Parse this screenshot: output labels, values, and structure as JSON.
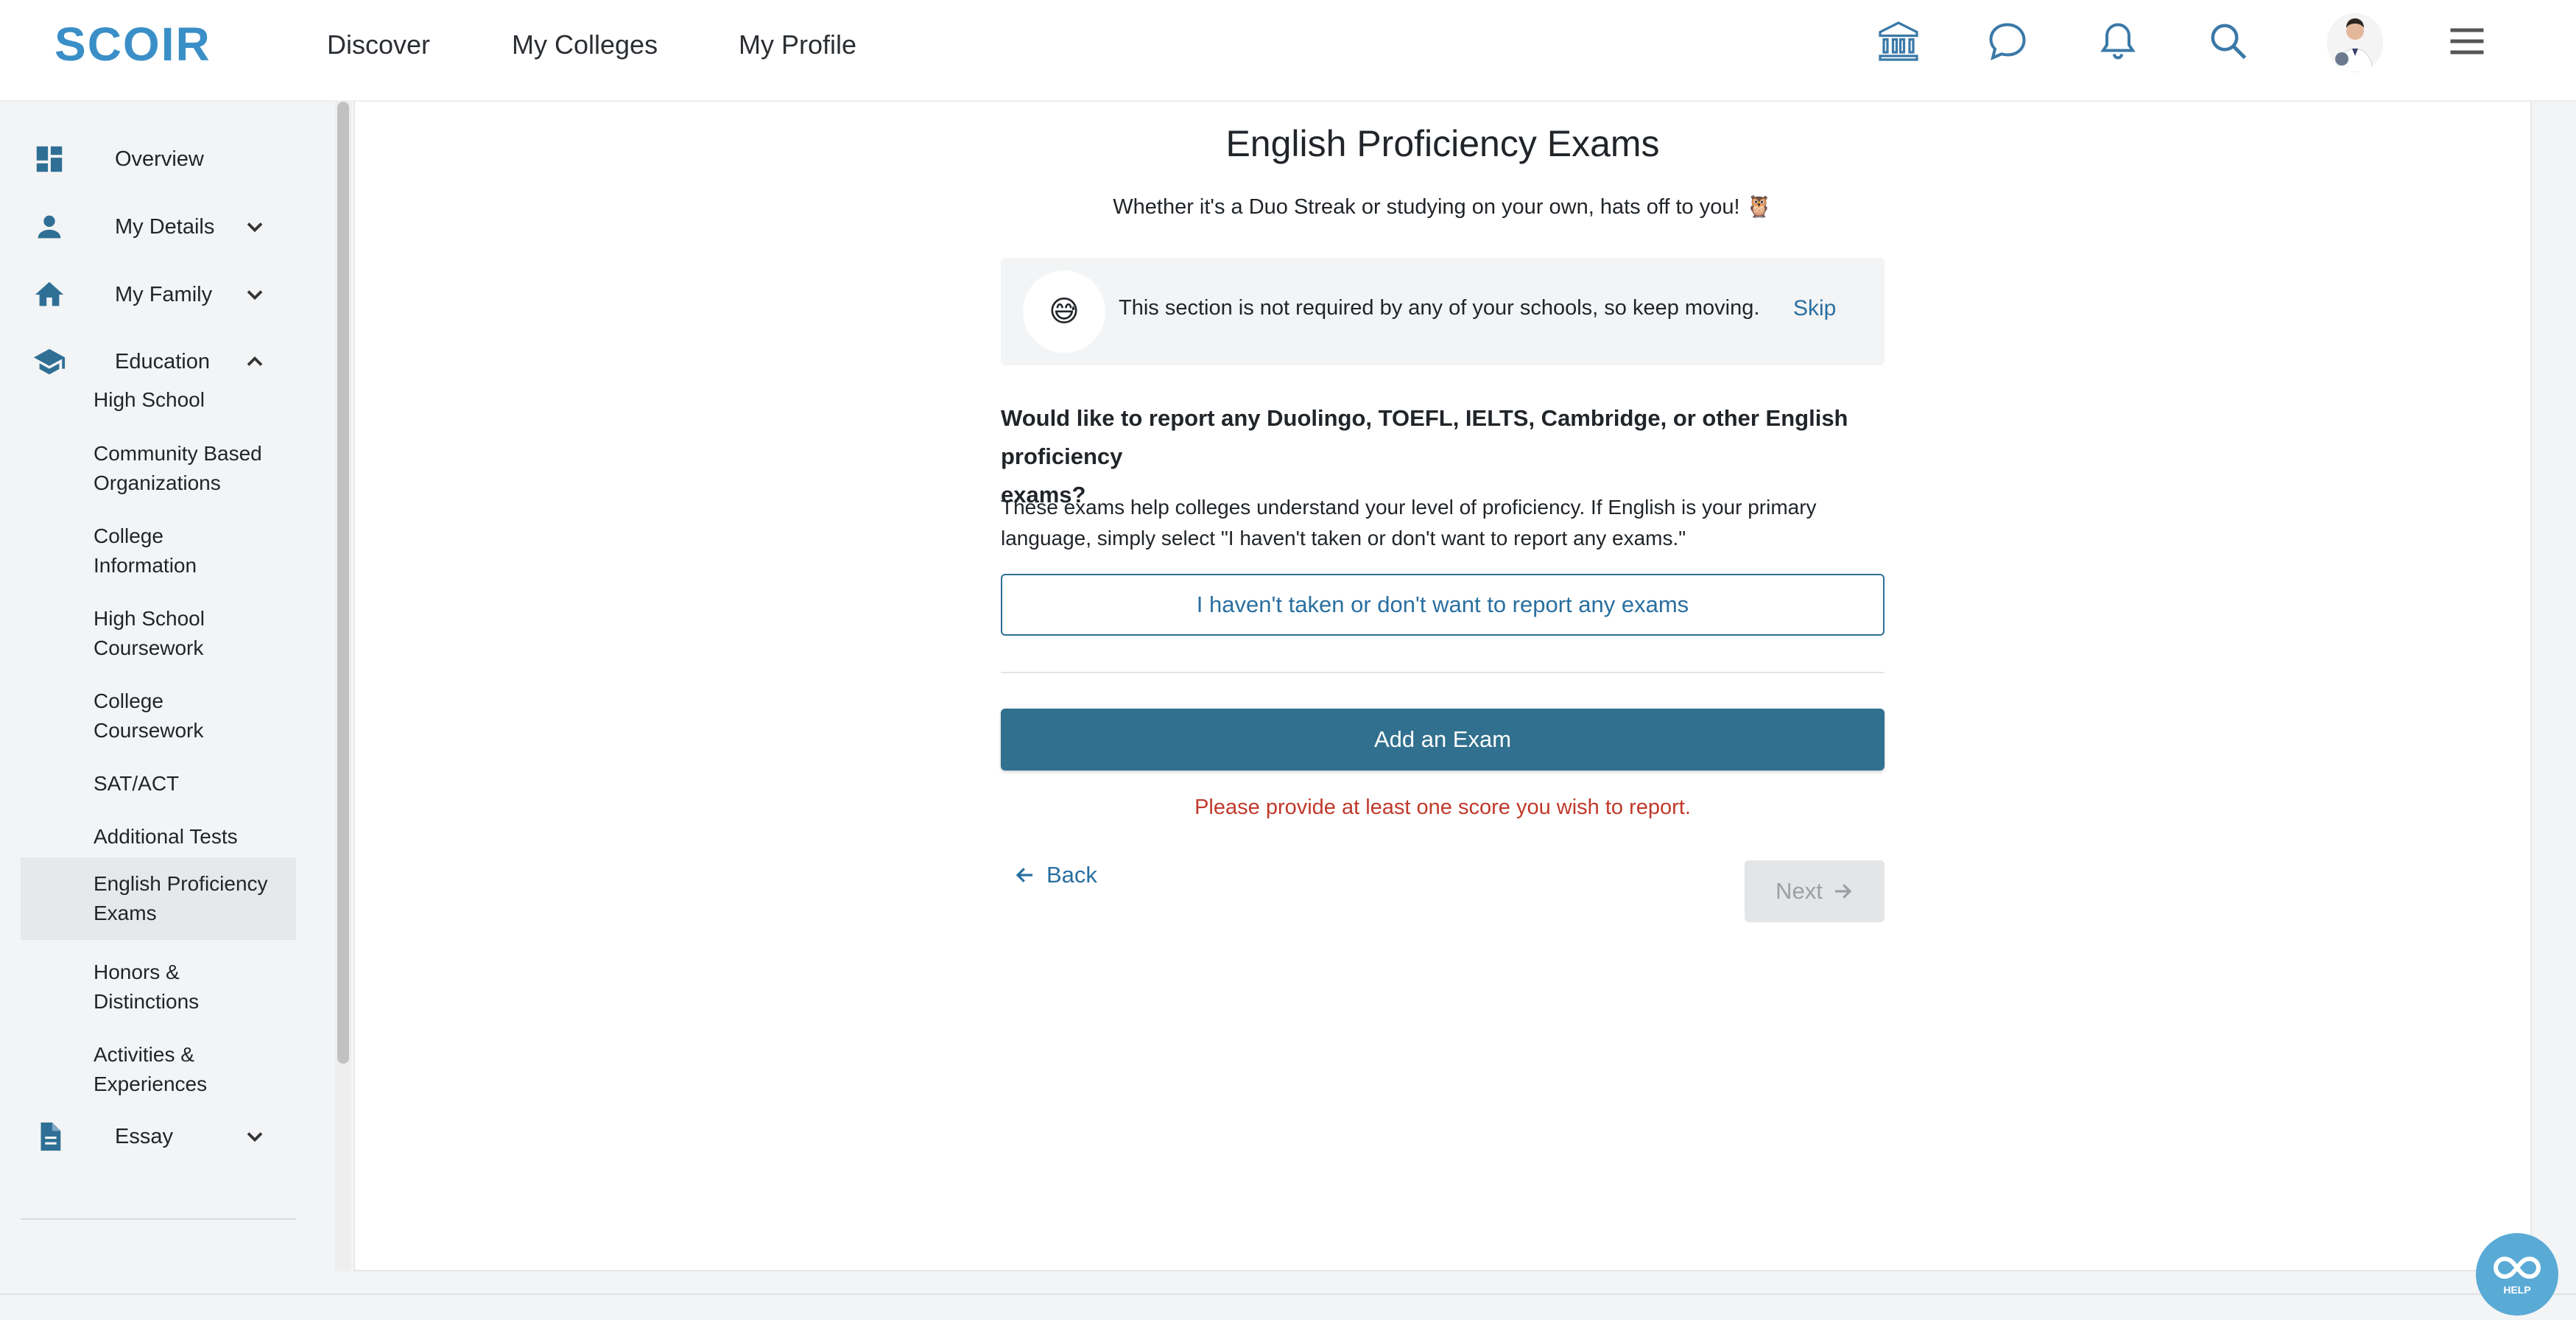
{
  "header": {
    "logo": "SCOIR",
    "nav": [
      "Discover",
      "My Colleges",
      "My Profile"
    ],
    "icons": [
      "institution-icon",
      "chat-bubble-icon",
      "bell-icon",
      "search-icon",
      "avatar",
      "hamburger-menu-icon"
    ]
  },
  "sidebar": {
    "top_items": [
      {
        "label": "Overview",
        "icon": "dashboard-icon"
      },
      {
        "label": "My Details",
        "icon": "person-icon",
        "chevron": "down"
      },
      {
        "label": "My Family",
        "icon": "home-icon",
        "chevron": "down"
      },
      {
        "label": "Education",
        "icon": "graduation-cap-icon",
        "chevron": "up"
      },
      {
        "label": "Essay",
        "icon": "document-icon",
        "chevron": "down"
      }
    ],
    "education_items": [
      {
        "line1": "High School",
        "line2": ""
      },
      {
        "line1": "Community Based",
        "line2": "Organizations"
      },
      {
        "line1": "College",
        "line2": "Information"
      },
      {
        "line1": "High School",
        "line2": "Coursework"
      },
      {
        "line1": "College",
        "line2": "Coursework"
      },
      {
        "line1": "SAT/ACT",
        "line2": ""
      },
      {
        "line1": "Additional Tests",
        "line2": ""
      },
      {
        "line1": "English Proficiency",
        "line2": "Exams",
        "active": true
      },
      {
        "line1": "Honors &",
        "line2": "Distinctions"
      },
      {
        "line1": "Activities &",
        "line2": "Experiences"
      }
    ]
  },
  "main": {
    "title": "English Proficiency Exams",
    "subtitle": "Whether it's a Duo Streak or studying on your own, hats off to you! 🦉",
    "notice": {
      "emoji": "😅",
      "message": "This section is not required by any of your schools, so keep moving.",
      "skip_label": "Skip"
    },
    "question_line1": "Would like to report any Duolingo, TOEFL, IELTS, Cambridge, or other English proficiency",
    "question_line2": "exams?",
    "description_line1": "These exams help colleges understand your level of proficiency. If English is your primary",
    "description_line2": "language, simply select \"I haven't taken or don't want to report any exams.\"",
    "no_exams_button": "I haven't taken or don't want to report any exams",
    "add_exam_button": "Add an Exam",
    "error_message": "Please provide at least one score you wish to report.",
    "back_label": "Back",
    "next_label": "Next"
  },
  "help": {
    "label": "HELP"
  },
  "colors": {
    "brand_blue": "#3a8fc7",
    "primary_button": "#31708f",
    "link": "#2a6fa0",
    "error": "#c0392b"
  }
}
